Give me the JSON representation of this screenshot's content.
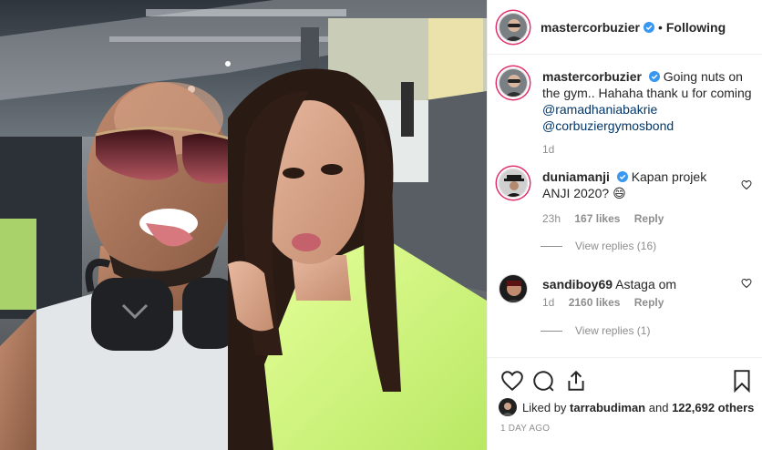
{
  "post": {
    "author": "mastercorbuzier",
    "follow_state": "Following",
    "separator": "•"
  },
  "caption": {
    "username": "mastercorbuzier",
    "text": "Going nuts on the gym.. Hahaha thank u for coming",
    "mention1": "@ramadhaniabakrie",
    "mention2": "@corbuziergymosbond",
    "time": "1d"
  },
  "comments": [
    {
      "username": "duniamanji",
      "text": "Kapan projek ANJI 2020?",
      "emoji": "😄",
      "time": "23h",
      "likes": "167 likes",
      "reply": "Reply",
      "view_replies": "View replies (16)"
    },
    {
      "username": "sandiboy69",
      "text": "Astaga om",
      "time": "1d",
      "likes": "2160 likes",
      "reply": "Reply",
      "view_replies": "View replies (1)"
    }
  ],
  "footer": {
    "liked_by_prefix": "Liked by",
    "liked_by_user": "tarrabudiman",
    "liked_by_and": "and",
    "liked_by_others": "122,692 others",
    "time_ago": "1 DAY AGO"
  },
  "icons": {
    "like": "heart-icon",
    "comment": "comment-icon",
    "share": "share-icon",
    "save": "bookmark-icon",
    "verified": "verified-badge-icon"
  },
  "colors": {
    "mention": "#00376b",
    "verified": "#3897f0",
    "secondary_text": "#8e8e8e",
    "story_ring": "#e1306c"
  }
}
